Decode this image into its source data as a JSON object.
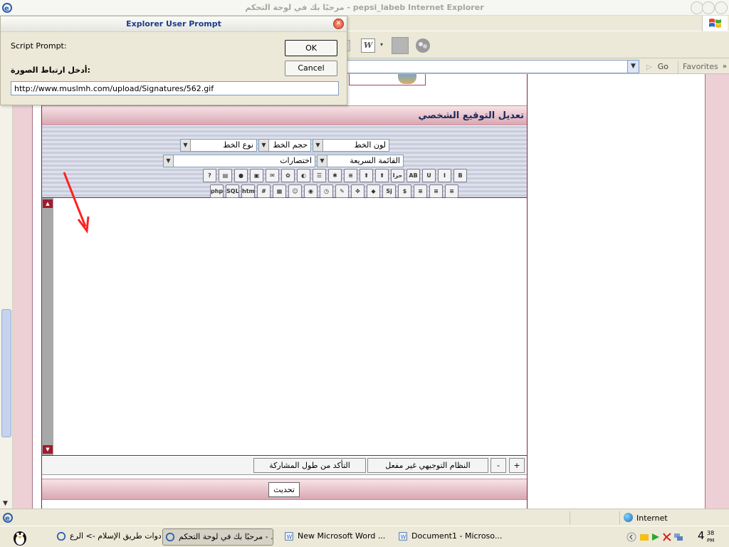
{
  "window": {
    "title": "مرحبًا بك في لوحة التحكم - pepsi_labeb Internet Explorer"
  },
  "toolbar": {
    "word_glyph": "W",
    "dropdown_glyph": "▾"
  },
  "addressbar": {
    "go_label": "Go",
    "favorites_label": "Favorites",
    "go_arrow": "▷",
    "chevron": "»"
  },
  "dialog": {
    "title": "Explorer User Prompt",
    "close_glyph": "✕",
    "script_prompt_label": "Script Prompt:",
    "prompt_text": "أدخل ارتباط الصورة:",
    "ok_label": "OK",
    "cancel_label": "Cancel",
    "input_value": "http://www.muslmh.com/upload/Signatures/562.gif"
  },
  "form": {
    "title": "تعديل التوقيع الشخصي",
    "font_color_label": "لون الخط",
    "font_size_label": "حجم الخط",
    "font_type_label": "نوع الخط",
    "quick_list_label": "القائمة السريعة",
    "shortcuts_label": "اختصارات",
    "toolbar_row1": [
      {
        "name": "bold-button",
        "label": "B"
      },
      {
        "name": "italic-button",
        "label": "I"
      },
      {
        "name": "underline-button",
        "label": "U"
      },
      {
        "name": "strike-button",
        "label": "AB"
      },
      {
        "name": "arabic-text-button",
        "label": "حرا"
      },
      {
        "name": "link-button",
        "label": "⬆"
      },
      {
        "name": "email-link-button",
        "label": "⬆"
      },
      {
        "name": "align-button",
        "label": "≡"
      },
      {
        "name": "glow-button",
        "label": "✱"
      },
      {
        "name": "list-button",
        "label": "☰"
      },
      {
        "name": "globe-button",
        "label": "◐"
      },
      {
        "name": "flash-button",
        "label": "✿"
      },
      {
        "name": "mail-button",
        "label": "✉"
      },
      {
        "name": "image-button",
        "label": "▣"
      },
      {
        "name": "real-button",
        "label": "●"
      },
      {
        "name": "doc-button",
        "label": "▤"
      },
      {
        "name": "help-button",
        "label": "?"
      }
    ],
    "toolbar_row2": [
      {
        "name": "justify-right-button",
        "label": "≡"
      },
      {
        "name": "justify-center-button",
        "label": "≡"
      },
      {
        "name": "justify-left-button",
        "label": "≡"
      },
      {
        "name": "dollar-button",
        "label": "$"
      },
      {
        "name": "sj-button",
        "label": "Sj"
      },
      {
        "name": "green-button",
        "label": "◆"
      },
      {
        "name": "move-button",
        "label": "✥"
      },
      {
        "name": "draw-button",
        "label": "✎"
      },
      {
        "name": "timer-button",
        "label": "◷"
      },
      {
        "name": "media-button",
        "label": "◉"
      },
      {
        "name": "smile-button",
        "label": "☺"
      },
      {
        "name": "table-button",
        "label": "▦"
      },
      {
        "name": "hash-button",
        "label": "#"
      },
      {
        "name": "html-button",
        "label": "htm"
      },
      {
        "name": "sql-button",
        "label": "SQL"
      },
      {
        "name": "php-button",
        "label": "php"
      }
    ],
    "plus_label": "+",
    "minus_label": "-",
    "guided_mode_label": "النظام التوجيهي غير مفعل",
    "check_length_label": "التأكد من طول المشاركة",
    "update_label": "تحديث",
    "up_glyph": "▲",
    "down_glyph": "▼"
  },
  "statusbar": {
    "zone_label": "Internet"
  },
  "taskbar": {
    "tasks": [
      {
        "label": "أدوات طريق الإسلام -> الرع..."
      },
      {
        "label": "مرحبًا بك في لوحة التحكم - ..."
      },
      {
        "label": "New Microsoft Word ..."
      },
      {
        "label": "Document1 - Microso..."
      }
    ],
    "clock_hour": "4",
    "clock_minute": "38",
    "clock_ampm": "PM"
  }
}
